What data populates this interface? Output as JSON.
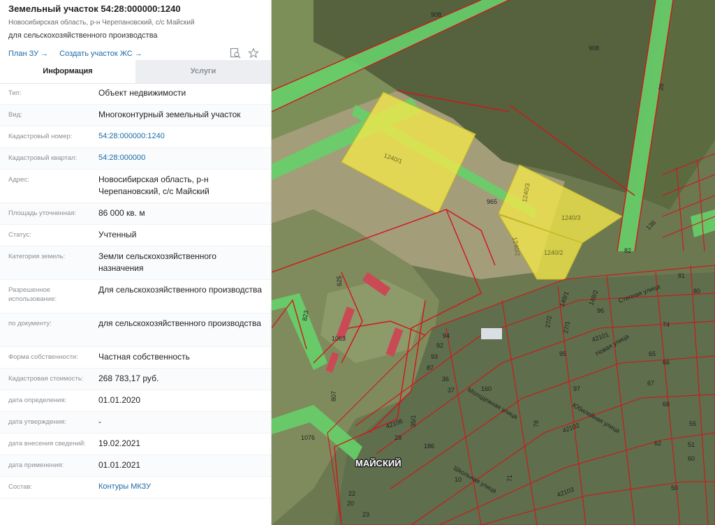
{
  "header": {
    "title": "Земельный участок 54:28:000000:1240",
    "address_line": "Новосибирская область, р-н Черепановский, с/с Майский",
    "purpose": "для сельскохозяйственного производства",
    "link_plan": "План ЗУ →",
    "link_create": "Создать участок ЖС →"
  },
  "tabs": [
    {
      "label": "Информация",
      "active": true
    },
    {
      "label": "Услуги",
      "active": false
    }
  ],
  "rows": [
    {
      "label": "Тип:",
      "value": "Объект недвижимости",
      "link": false
    },
    {
      "label": "Вид:",
      "value": "Многоконтурный земельный участок",
      "link": false
    },
    {
      "label": "Кадастровый номер:",
      "value": "54:28:000000:1240",
      "link": true
    },
    {
      "label": "Кадастровый квартал:",
      "value": "54:28:000000",
      "link": true
    },
    {
      "label": "Адрес:",
      "value": "Новосибирская область, р-н Черепановский, с/с Майский",
      "link": false
    },
    {
      "label": "Площадь уточненная:",
      "value": "86 000 кв. м",
      "link": false
    },
    {
      "label": "Статус:",
      "value": "Учтенный",
      "link": false
    },
    {
      "label": "Категория земель:",
      "value": "Земли сельскохозяйственного назначения",
      "link": false
    },
    {
      "label": "Разрешенное использование:",
      "value": "Для сельскохозяйственного производства",
      "link": false
    },
    {
      "label": "по документу:",
      "value": "для сельскохозяйственного производства",
      "link": false
    },
    {
      "label": "Форма собственности:",
      "value": "Частная собственность",
      "link": false
    },
    {
      "label": "Кадастровая стоимость:",
      "value": "268 783,17 руб.",
      "link": false
    },
    {
      "label": "дата определения:",
      "value": "01.01.2020",
      "link": false
    },
    {
      "label": "дата утверждения:",
      "value": "-",
      "link": false
    },
    {
      "label": "дата внесения сведений:",
      "value": "19.02.2021",
      "link": false
    },
    {
      "label": "дата применения:",
      "value": "01.01.2021",
      "link": false
    },
    {
      "label": "Состав:",
      "value": "Контуры МКЗУ",
      "link": true
    }
  ],
  "map": {
    "place_name": "МАЙСКИЙ",
    "parcels": [
      "1240/1",
      "1240/3",
      "1240/3",
      "1240/2",
      "1240/2"
    ],
    "road_numbers": [
      "908",
      "908",
      "26",
      "965"
    ],
    "plot_numbers": [
      "625",
      "823",
      "1063",
      "1076",
      "807",
      "42106",
      "42102",
      "42103",
      "42101",
      "136",
      "160",
      "186",
      "92",
      "93",
      "94",
      "87",
      "36",
      "37",
      "28",
      "20",
      "22",
      "23",
      "82",
      "81",
      "80",
      "74",
      "65",
      "66",
      "67",
      "68",
      "55",
      "60",
      "62",
      "50",
      "51",
      "96",
      "95",
      "97",
      "35/1",
      "27/1",
      "27/2",
      "149/2",
      "149/1",
      "10",
      "71",
      "78"
    ],
    "streets": [
      "Степная улица",
      "Новая улица",
      "Юбилейная улица",
      "Молодежная улица",
      "Школьная улица"
    ],
    "colors": {
      "parcel_fill": "#f3e84a",
      "road_fill": "#67d06a",
      "border": "#d0161b",
      "field_dark": "#56623e",
      "field_light": "#a39d7a"
    }
  }
}
